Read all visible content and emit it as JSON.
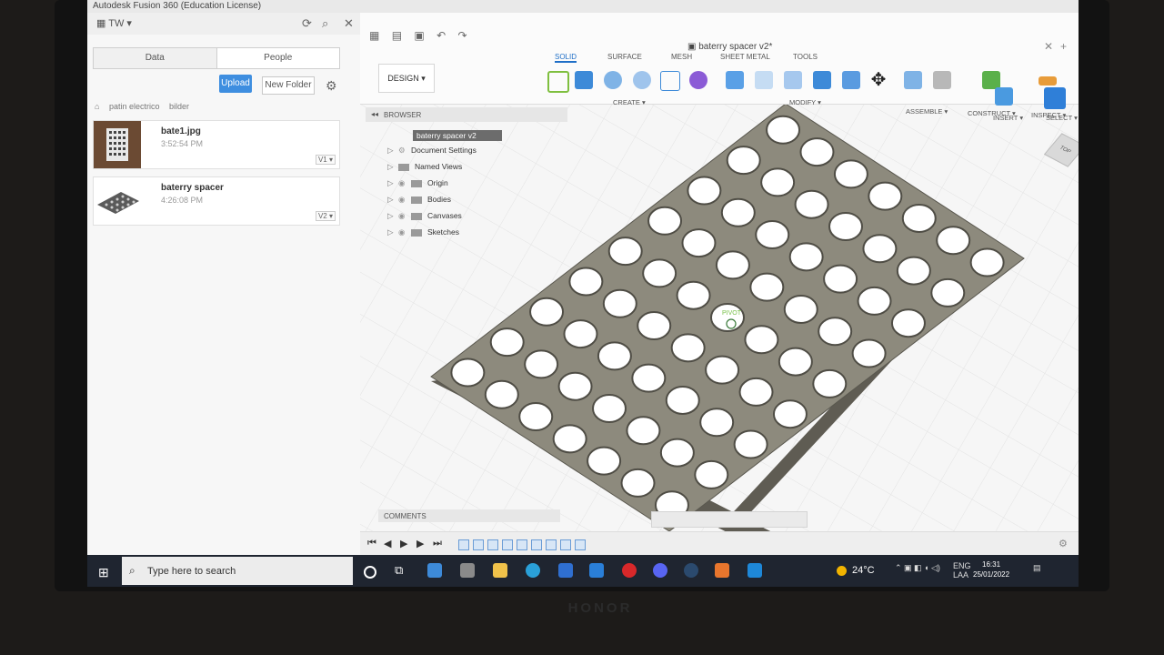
{
  "window": {
    "title": "Autodesk Fusion 360 (Education License)"
  },
  "data_panel": {
    "team": "TW",
    "tabs": [
      {
        "label": "Data"
      },
      {
        "label": "People"
      }
    ],
    "upload_label": "Upload",
    "new_folder_label": "New Folder",
    "breadcrumb": [
      "patin electrico",
      "bilder"
    ],
    "files": [
      {
        "name": "bate1.jpg",
        "time": "3:52:54 PM",
        "version": "V1 ▾"
      },
      {
        "name": "baterry spacer",
        "time": "4:26:08 PM",
        "version": "V2 ▾"
      }
    ]
  },
  "toolbar": {
    "doc_title": "baterry spacer v2*",
    "design_label": "DESIGN ▾",
    "tabs": [
      "SOLID",
      "SURFACE",
      "MESH",
      "SHEET METAL",
      "TOOLS"
    ],
    "groups": [
      "CREATE ▾",
      "MODIFY ▾",
      "ASSEMBLE ▾",
      "CONSTRUCT ▾",
      "INSPECT ▾",
      "INSERT ▾",
      "SELECT ▾"
    ]
  },
  "browser": {
    "title": "BROWSER",
    "root": "baterry spacer v2",
    "items": [
      "Document Settings",
      "Named Views",
      "Origin",
      "Bodies",
      "Canvases",
      "Sketches"
    ]
  },
  "canvas": {
    "pivot_label": "PIVOT",
    "viewcube_label": "TOP"
  },
  "comments_label": "COMMENTS",
  "taskbar": {
    "search_placeholder": "Type here to search",
    "weather": "24°C",
    "lang": "ENG",
    "lang_sub": "LAA",
    "time": "16:31",
    "date": "25/01/2022"
  },
  "bezel_brand": "HONOR",
  "colors": {
    "accent": "#1f6fc7",
    "upload": "#3e8ee0",
    "plate": "#8d8a7d"
  }
}
